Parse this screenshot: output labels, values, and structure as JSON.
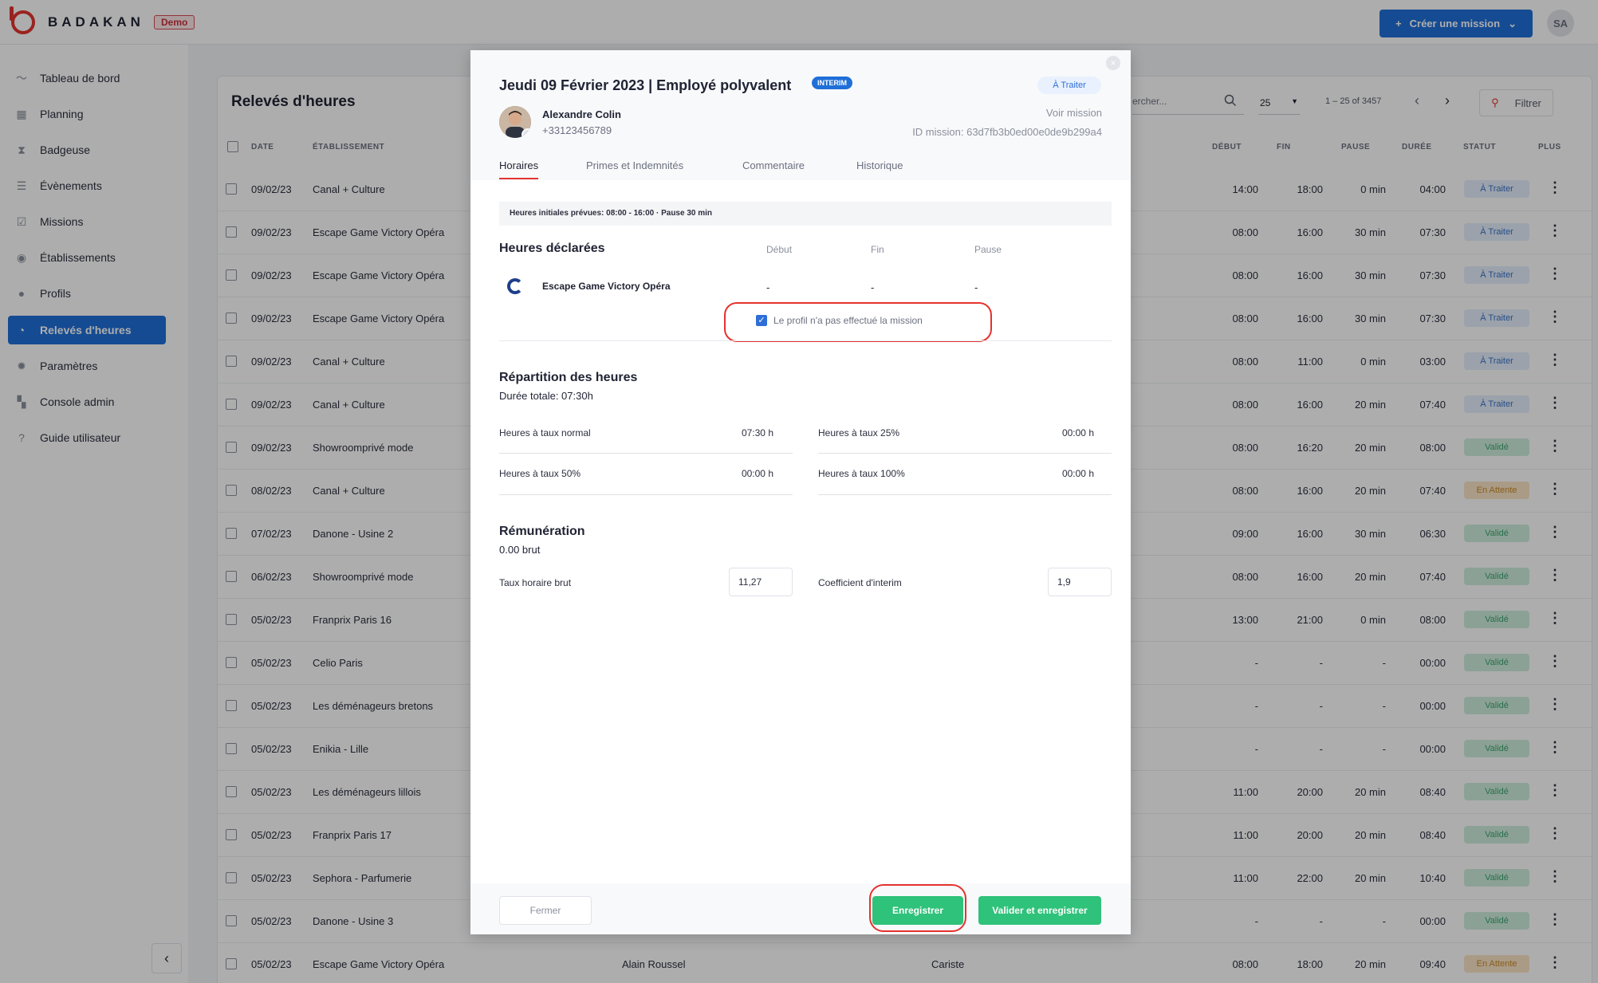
{
  "topbar": {
    "brand": "BADAKAN",
    "env_badge": "Demo",
    "create_button": "Créer une mission",
    "avatar_initials": "SA"
  },
  "sidebar": {
    "items": [
      {
        "label": "Tableau de bord",
        "icon": "pulse-icon"
      },
      {
        "label": "Planning",
        "icon": "calendar-icon"
      },
      {
        "label": "Badgeuse",
        "icon": "hourglass-icon"
      },
      {
        "label": "Évènements",
        "icon": "list-icon"
      },
      {
        "label": "Missions",
        "icon": "check-square-icon"
      },
      {
        "label": "Établissements",
        "icon": "building-icon"
      },
      {
        "label": "Profils",
        "icon": "user-icon"
      },
      {
        "label": "Relevés d'heures",
        "icon": "clock-icon",
        "active": true
      },
      {
        "label": "Paramètres",
        "icon": "gear-icon"
      },
      {
        "label": "Console admin",
        "icon": "grid-icon"
      },
      {
        "label": "Guide utilisateur",
        "icon": "help-icon"
      }
    ],
    "collapse": "‹"
  },
  "list": {
    "title": "Relevés d'heures",
    "search_placeholder": "ercher...",
    "per_page": "25",
    "range": "1 – 25 of 3457",
    "filter": "Filtrer",
    "headers": {
      "date": "DATE",
      "etablissement": "ÉTABLISSEMENT",
      "debut": "DÉBUT",
      "fin": "FIN",
      "pause": "PAUSE",
      "duree": "DURÉE",
      "statut": "STATUT",
      "plus": "PLUS"
    },
    "rows": [
      {
        "date": "09/02/23",
        "etab": "Canal + Culture",
        "profil": "",
        "poste": "",
        "debut": "14:00",
        "fin": "18:00",
        "pause": "0 min",
        "duree": "04:00",
        "statut": "À Traiter",
        "kind": "todo"
      },
      {
        "date": "09/02/23",
        "etab": "Escape Game Victory Opéra",
        "profil": "",
        "poste": "",
        "debut": "08:00",
        "fin": "16:00",
        "pause": "30 min",
        "duree": "07:30",
        "statut": "À Traiter",
        "kind": "todo"
      },
      {
        "date": "09/02/23",
        "etab": "Escape Game Victory Opéra",
        "profil": "",
        "poste": "",
        "debut": "08:00",
        "fin": "16:00",
        "pause": "30 min",
        "duree": "07:30",
        "statut": "À Traiter",
        "kind": "todo"
      },
      {
        "date": "09/02/23",
        "etab": "Escape Game Victory Opéra",
        "profil": "",
        "poste": "",
        "debut": "08:00",
        "fin": "16:00",
        "pause": "30 min",
        "duree": "07:30",
        "statut": "À Traiter",
        "kind": "todo"
      },
      {
        "date": "09/02/23",
        "etab": "Canal + Culture",
        "profil": "",
        "poste": "",
        "debut": "08:00",
        "fin": "11:00",
        "pause": "0 min",
        "duree": "03:00",
        "statut": "À Traiter",
        "kind": "todo"
      },
      {
        "date": "09/02/23",
        "etab": "Canal + Culture",
        "profil": "",
        "poste": "",
        "debut": "08:00",
        "fin": "16:00",
        "pause": "20 min",
        "duree": "07:40",
        "statut": "À Traiter",
        "kind": "todo"
      },
      {
        "date": "09/02/23",
        "etab": "Showroomprivé mode",
        "profil": "",
        "poste": "",
        "debut": "08:00",
        "fin": "16:20",
        "pause": "20 min",
        "duree": "08:00",
        "statut": "Validé",
        "kind": "ok"
      },
      {
        "date": "08/02/23",
        "etab": "Canal + Culture",
        "profil": "",
        "poste": "",
        "debut": "08:00",
        "fin": "16:00",
        "pause": "20 min",
        "duree": "07:40",
        "statut": "En Attente",
        "kind": "wait"
      },
      {
        "date": "07/02/23",
        "etab": "Danone - Usine 2",
        "profil": "",
        "poste": "",
        "debut": "09:00",
        "fin": "16:00",
        "pause": "30 min",
        "duree": "06:30",
        "statut": "Validé",
        "kind": "ok"
      },
      {
        "date": "06/02/23",
        "etab": "Showroomprivé mode",
        "profil": "",
        "poste": "",
        "debut": "08:00",
        "fin": "16:00",
        "pause": "20 min",
        "duree": "07:40",
        "statut": "Validé",
        "kind": "ok"
      },
      {
        "date": "05/02/23",
        "etab": "Franprix Paris 16",
        "profil": "",
        "poste": "",
        "debut": "13:00",
        "fin": "21:00",
        "pause": "0 min",
        "duree": "08:00",
        "statut": "Validé",
        "kind": "ok"
      },
      {
        "date": "05/02/23",
        "etab": "Celio Paris",
        "profil": "",
        "poste": "",
        "debut": "-",
        "fin": "-",
        "pause": "-",
        "duree": "00:00",
        "statut": "Validé",
        "kind": "ok"
      },
      {
        "date": "05/02/23",
        "etab": "Les déménageurs bretons",
        "profil": "",
        "poste": "",
        "debut": "-",
        "fin": "-",
        "pause": "-",
        "duree": "00:00",
        "statut": "Validé",
        "kind": "ok"
      },
      {
        "date": "05/02/23",
        "etab": "Enikia - Lille",
        "profil": "",
        "poste": "",
        "debut": "-",
        "fin": "-",
        "pause": "-",
        "duree": "00:00",
        "statut": "Validé",
        "kind": "ok"
      },
      {
        "date": "05/02/23",
        "etab": "Les déménageurs lillois",
        "profil": "",
        "poste": "",
        "debut": "11:00",
        "fin": "20:00",
        "pause": "20 min",
        "duree": "08:40",
        "statut": "Validé",
        "kind": "ok"
      },
      {
        "date": "05/02/23",
        "etab": "Franprix Paris 17",
        "profil": "",
        "poste": "",
        "debut": "11:00",
        "fin": "20:00",
        "pause": "20 min",
        "duree": "08:40",
        "statut": "Validé",
        "kind": "ok"
      },
      {
        "date": "05/02/23",
        "etab": "Sephora - Parfumerie",
        "profil": "",
        "poste": "",
        "debut": "11:00",
        "fin": "22:00",
        "pause": "20 min",
        "duree": "10:40",
        "statut": "Validé",
        "kind": "ok"
      },
      {
        "date": "05/02/23",
        "etab": "Danone - Usine 3",
        "profil": "",
        "poste": "",
        "debut": "-",
        "fin": "-",
        "pause": "-",
        "duree": "00:00",
        "statut": "Validé",
        "kind": "ok"
      },
      {
        "date": "05/02/23",
        "etab": "Escape Game Victory Opéra",
        "profil": "Alain Roussel",
        "poste": "Cariste",
        "debut": "08:00",
        "fin": "18:00",
        "pause": "20 min",
        "duree": "09:40",
        "statut": "En Attente",
        "kind": "wait"
      }
    ]
  },
  "modal": {
    "title": "Jeudi 09 Février 2023 | Employé polyvalent",
    "badge": "INTERIM",
    "status": "À Traiter",
    "person_name": "Alexandre Colin",
    "person_phone": "+33123456789",
    "voir_mission": "Voir mission",
    "mission_id": "ID mission: 63d7fb3b0ed00e0de9b299a4",
    "tabs": [
      "Horaires",
      "Primes et Indemnités",
      "Commentaire",
      "Historique"
    ],
    "info": "Heures initiales prévues: 08:00 - 16:00 · Pause 30 min",
    "declared": {
      "title": "Heures déclarées",
      "col_debut": "Début",
      "col_fin": "Fin",
      "col_pause": "Pause",
      "etab": "Escape Game Victory Opéra",
      "debut": "-",
      "fin": "-",
      "pause": "-",
      "not_done_label": "Le profil n'a pas effectué la mission"
    },
    "repartition": {
      "title": "Répartition des heures",
      "total": "Durée totale: 07:30h",
      "items": [
        {
          "label": "Heures à taux normal",
          "value": "07:30 h"
        },
        {
          "label": "Heures à taux 25%",
          "value": "00:00 h"
        },
        {
          "label": "Heures à taux 50%",
          "value": "00:00 h"
        },
        {
          "label": "Heures à taux 100%",
          "value": "00:00 h"
        }
      ]
    },
    "remuneration": {
      "title": "Rémunération",
      "total": "0.00 brut",
      "taux_label": "Taux horaire brut",
      "taux_value": "11,27",
      "coef_label": "Coefficient d'interim",
      "coef_value": "1,9"
    },
    "buttons": {
      "fermer": "Fermer",
      "enregistrer": "Enregistrer",
      "valider": "Valider et enregistrer"
    }
  },
  "colors": {
    "primary": "#1f6fd8",
    "success": "#2fc27a",
    "danger": "#e3342f"
  }
}
